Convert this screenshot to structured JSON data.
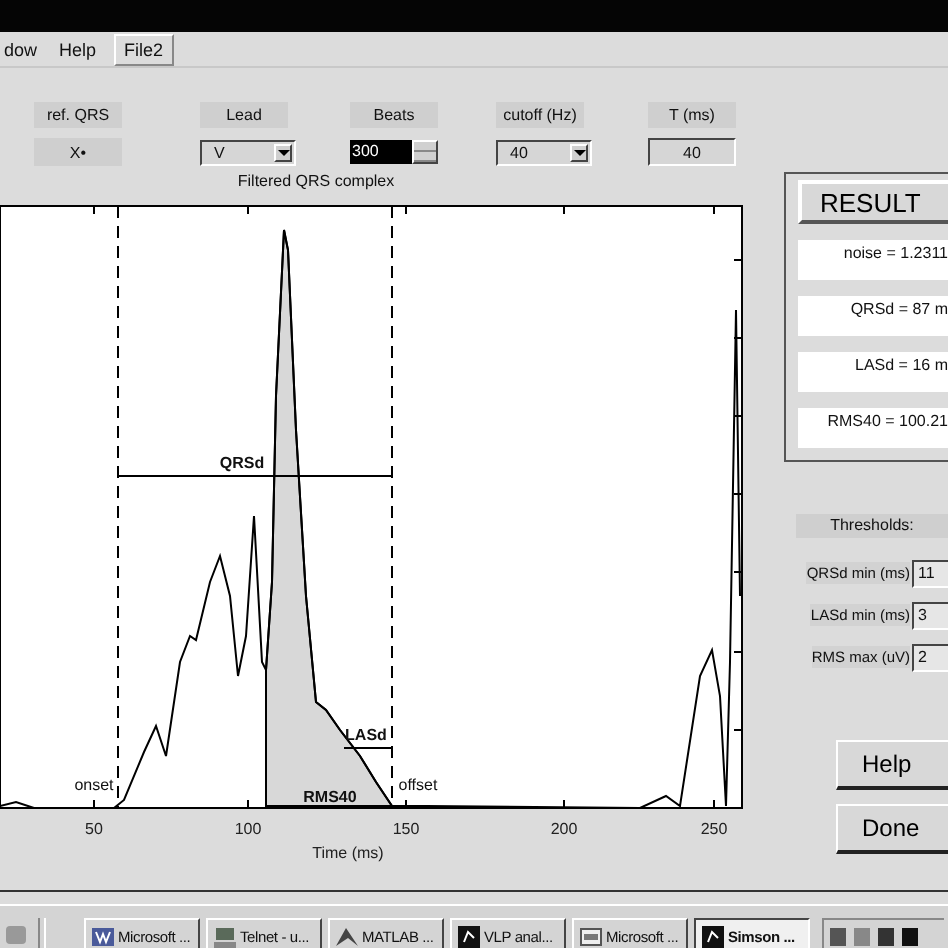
{
  "menu": [
    {
      "label": "dow",
      "selected": false
    },
    {
      "label": "Help",
      "selected": false
    },
    {
      "label": "File2",
      "selected": true
    }
  ],
  "controls": [
    {
      "label": "ref. QRS",
      "kind": "display",
      "value": "X•"
    },
    {
      "label": "Lead",
      "kind": "dropdown",
      "value": "V"
    },
    {
      "label": "Beats",
      "kind": "spinner",
      "value": "300"
    },
    {
      "label": "cutoff (Hz)",
      "kind": "dropdown",
      "value": "40"
    },
    {
      "label": "T (ms)",
      "kind": "field",
      "value": "40"
    }
  ],
  "plot": {
    "title": "Filtered QRS complex",
    "xlabel": "Time (ms)",
    "xticks": [
      "50",
      "100",
      "150",
      "200",
      "250"
    ],
    "annotations": [
      {
        "kind": "qrsd",
        "text": "QRSd"
      },
      {
        "kind": "lasd",
        "text": "LASd"
      },
      {
        "kind": "rms40",
        "text": "RMS40"
      },
      {
        "kind": "onset",
        "text": "onset"
      },
      {
        "kind": "offset",
        "text": "offset"
      }
    ]
  },
  "results": {
    "button": "RESULT",
    "lines": [
      "noise = 1.2311",
      "QRSd = 87 m",
      "LASd = 16 m",
      "RMS40 = 100.21"
    ]
  },
  "thresholds": {
    "title": "Thresholds:",
    "rows": [
      {
        "label": "QRSd min (ms)",
        "value": "11"
      },
      {
        "label": "LASd min (ms)",
        "value": "3"
      },
      {
        "label": "RMS max (uV)",
        "value": "2"
      }
    ]
  },
  "buttons": [
    "Help",
    "Done"
  ],
  "taskbar": [
    {
      "label": "Microsoft ...",
      "kind": "doc",
      "selected": false
    },
    {
      "label": "Telnet - u...",
      "kind": "terminal",
      "selected": false
    },
    {
      "label": "MATLAB ...",
      "kind": "matlab",
      "selected": false
    },
    {
      "label": "VLP anal...",
      "kind": "figure",
      "selected": false
    },
    {
      "label": "Microsoft ...",
      "kind": "window",
      "selected": false
    },
    {
      "label": "Simson ...",
      "kind": "figure",
      "selected": true
    }
  ]
}
